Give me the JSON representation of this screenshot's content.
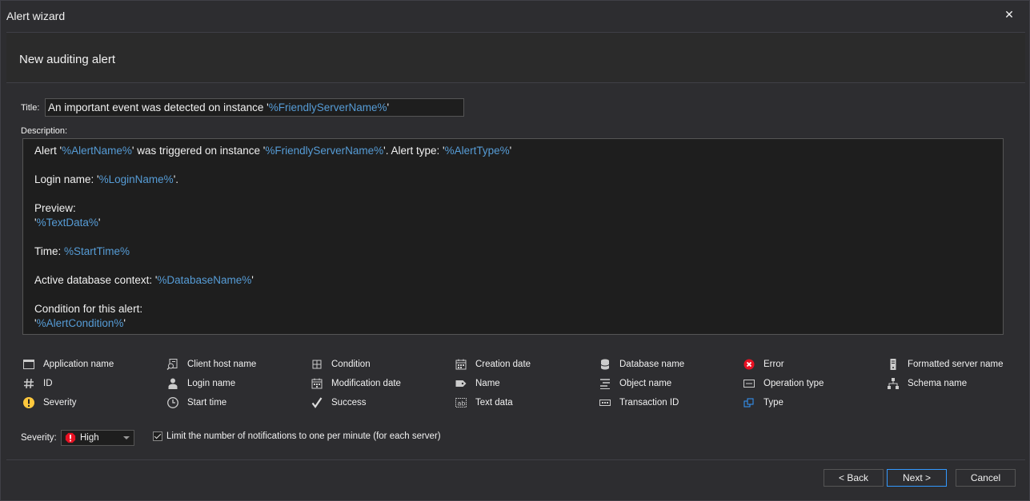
{
  "window": {
    "title": "Alert wizard",
    "close_glyph": "✕"
  },
  "header": {
    "heading": "New auditing alert"
  },
  "form": {
    "title_label": "Title:",
    "title_parts": [
      "An important event was detected on instance '",
      "%FriendlyServerName%",
      "'"
    ],
    "description_label": "Description:",
    "description_lines": [
      [
        {
          "t": "Alert '"
        },
        {
          "v": "%AlertName%"
        },
        {
          "t": "' was triggered on instance '"
        },
        {
          "v": "%FriendlyServerName%"
        },
        {
          "t": "'. Alert type: '"
        },
        {
          "v": "%AlertType%"
        },
        {
          "t": "'"
        }
      ],
      [],
      [
        {
          "t": "Login name: '"
        },
        {
          "v": "%LoginName%"
        },
        {
          "t": "'."
        }
      ],
      [],
      [
        {
          "t": "Preview:"
        }
      ],
      [
        {
          "t": "'"
        },
        {
          "v": "%TextData%"
        },
        {
          "t": "'"
        }
      ],
      [],
      [
        {
          "t": "Time: "
        },
        {
          "v": "%StartTime%"
        }
      ],
      [],
      [
        {
          "t": "Active database context: '"
        },
        {
          "v": "%DatabaseName%"
        },
        {
          "t": "'"
        }
      ],
      [],
      [
        {
          "t": "Condition for this alert:"
        }
      ],
      [
        {
          "t": "'"
        },
        {
          "v": "%AlertCondition%"
        },
        {
          "t": "'"
        }
      ]
    ]
  },
  "variables": [
    {
      "label": "Application name",
      "icon": "window-icon"
    },
    {
      "label": "Client host name",
      "icon": "host-search-icon"
    },
    {
      "label": "Condition",
      "icon": "condition-icon"
    },
    {
      "label": "Creation date",
      "icon": "calendar-icon"
    },
    {
      "label": "Database name",
      "icon": "database-icon"
    },
    {
      "label": "Error",
      "icon": "error-icon"
    },
    {
      "label": "Formatted server name",
      "icon": "server-icon"
    },
    {
      "label": "ID",
      "icon": "hash-icon"
    },
    {
      "label": "Login name",
      "icon": "user-icon"
    },
    {
      "label": "Modification date",
      "icon": "calendar-edit-icon"
    },
    {
      "label": "Name",
      "icon": "tag-icon"
    },
    {
      "label": "Object name",
      "icon": "object-icon"
    },
    {
      "label": "Operation type",
      "icon": "operation-icon"
    },
    {
      "label": "Schema name",
      "icon": "schema-icon"
    },
    {
      "label": "Severity",
      "icon": "warning-icon"
    },
    {
      "label": "Start time",
      "icon": "clock-icon"
    },
    {
      "label": "Success",
      "icon": "checkmark-icon"
    },
    {
      "label": "Text data",
      "icon": "text-icon"
    },
    {
      "label": "Transaction ID",
      "icon": "transaction-icon"
    },
    {
      "label": "Type",
      "icon": "type-icon"
    }
  ],
  "severity": {
    "label": "Severity:",
    "value": "High",
    "icon": "high-severity-icon"
  },
  "limit": {
    "label": "Limit the number of notifications to one per minute (for each server)",
    "checked": true
  },
  "buttons": {
    "back": "< Back",
    "next": "Next >",
    "cancel": "Cancel"
  },
  "colors": {
    "variable": "#569cd6",
    "background": "#2d2d30",
    "error": "#e81123",
    "warning": "#ffc83d"
  }
}
